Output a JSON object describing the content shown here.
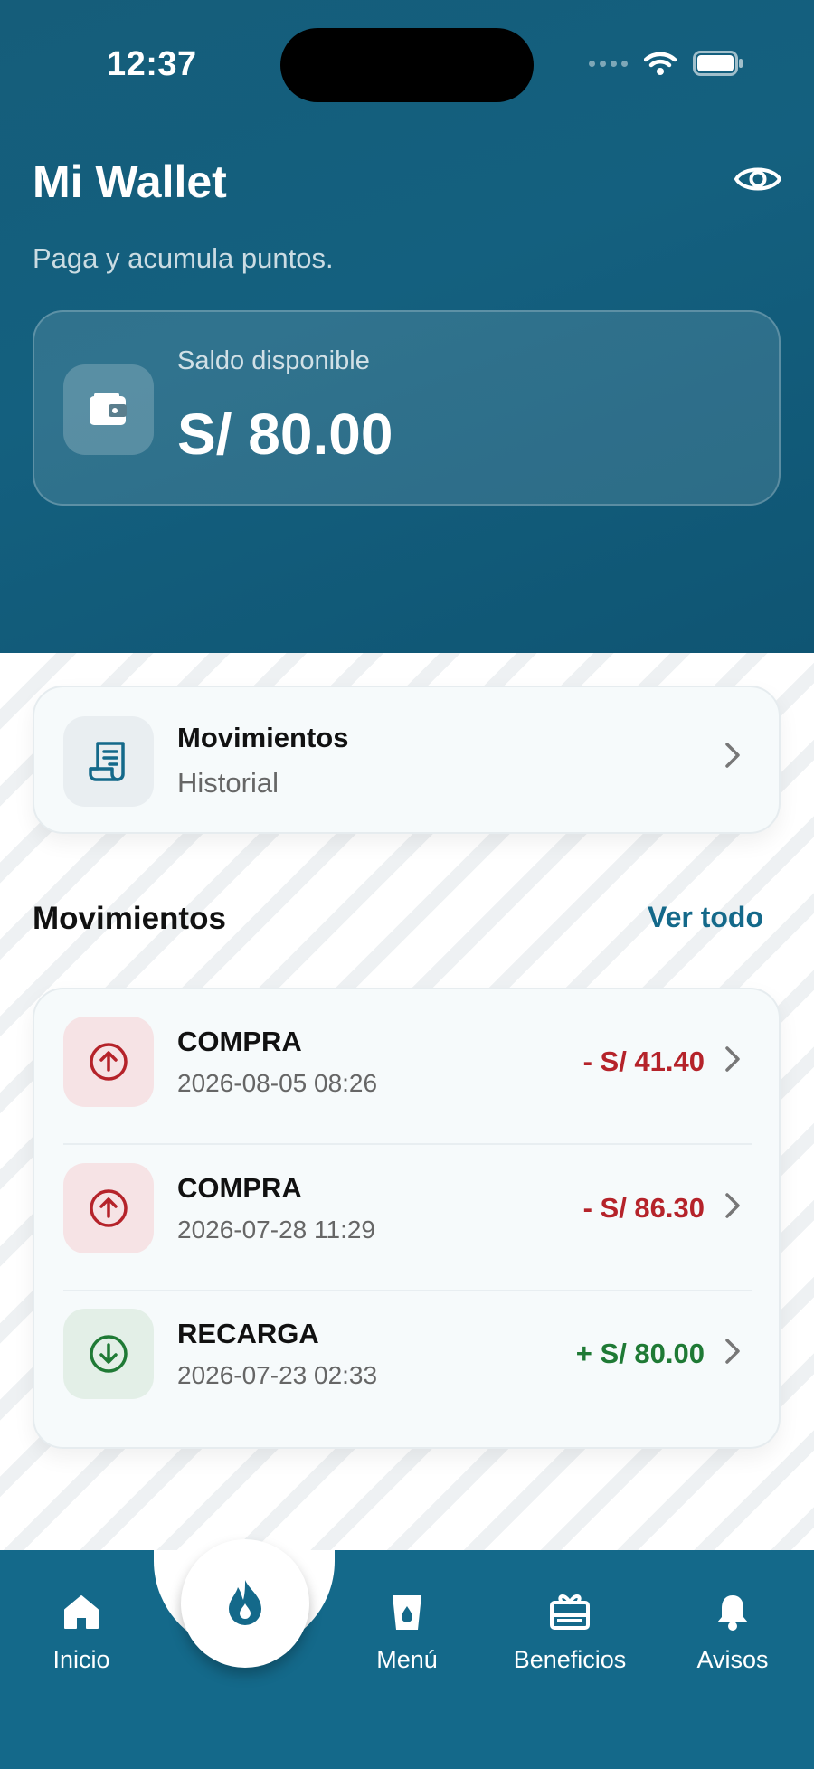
{
  "status_bar": {
    "time": "12:37"
  },
  "header": {
    "title": "Mi Wallet",
    "subtitle": "Paga y acumula puntos.",
    "icons": {
      "visibility": "eye-icon"
    }
  },
  "balance": {
    "label": "Saldo disponible",
    "amount": "S/ 80.00",
    "icon": "wallet-icon"
  },
  "history_card": {
    "title": "Movimientos",
    "subtitle": "Historial",
    "icon": "receipt-icon"
  },
  "movements": {
    "section_title": "Movimientos",
    "see_all": "Ver todo",
    "items": [
      {
        "type": "COMPRA",
        "date": "2026-08-05 08:26",
        "amount": "- S/ 41.40",
        "direction": "out"
      },
      {
        "type": "COMPRA",
        "date": "2026-07-28 11:29",
        "amount": "- S/ 86.30",
        "direction": "out"
      },
      {
        "type": "RECARGA",
        "date": "2026-07-23 02:33",
        "amount": "+ S/ 80.00",
        "direction": "in"
      }
    ]
  },
  "colors": {
    "header_bg": "#14607f",
    "nav_bg": "#14698a",
    "negative": "#b5232a",
    "positive": "#1f7a35",
    "link": "#14698a"
  },
  "nav": {
    "items": [
      {
        "label": "Inicio",
        "icon": "home-icon"
      },
      {
        "label": "",
        "icon": "flame-icon"
      },
      {
        "label": "Menú",
        "icon": "cup-icon"
      },
      {
        "label": "Beneficios",
        "icon": "gift-icon"
      },
      {
        "label": "Avisos",
        "icon": "bell-icon"
      }
    ]
  }
}
